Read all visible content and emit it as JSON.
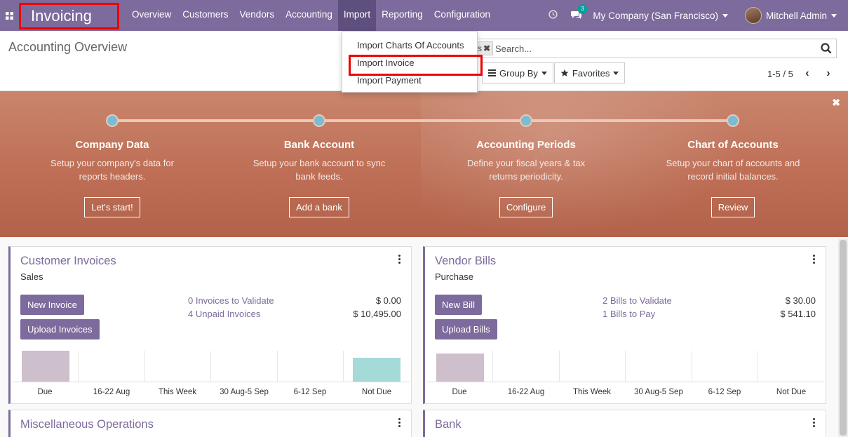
{
  "app": {
    "name": "Invoicing"
  },
  "nav": {
    "items": [
      "Overview",
      "Customers",
      "Vendors",
      "Accounting",
      "Import",
      "Reporting",
      "Configuration"
    ],
    "active": "Import"
  },
  "topbar": {
    "clock_icon": "clock-icon",
    "chat_badge": "3",
    "company": "My Company (San Francisco)",
    "user": "Mitchell Admin"
  },
  "import_menu": {
    "items": [
      "Import Charts Of Accounts",
      "Import Invoice",
      "Import Payment"
    ],
    "highlighted": "Import Invoice"
  },
  "control_panel": {
    "title": "Accounting Overview",
    "facet_text": "s",
    "search_placeholder": "Search...",
    "group_by": "Group By",
    "favorites": "Favorites",
    "pager": "1-5 / 5"
  },
  "onboarding": {
    "steps": [
      {
        "title": "Company Data",
        "desc1": "Setup your company's data for",
        "desc2": "reports headers.",
        "button": "Let's start!"
      },
      {
        "title": "Bank Account",
        "desc1": "Setup your bank account to sync",
        "desc2": "bank feeds.",
        "button": "Add a bank"
      },
      {
        "title": "Accounting Periods",
        "desc1": "Define your fiscal years & tax",
        "desc2": "returns periodicity.",
        "button": "Configure"
      },
      {
        "title": "Chart of Accounts",
        "desc1": "Setup your chart of accounts and",
        "desc2": "record initial balances.",
        "button": "Review"
      }
    ]
  },
  "cards": {
    "customer": {
      "title": "Customer Invoices",
      "subtitle": "Sales",
      "btn1": "New Invoice",
      "btn2": "Upload Invoices",
      "link1": "0 Invoices to Validate",
      "amount1": "$ 0.00",
      "link2": "4 Unpaid Invoices",
      "amount2": "$ 10,495.00",
      "chart_labels": [
        "Due",
        "16-22 Aug",
        "This Week",
        "30 Aug-5 Sep",
        "6-12 Sep",
        "Not Due"
      ]
    },
    "vendor": {
      "title": "Vendor Bills",
      "subtitle": "Purchase",
      "btn1": "New Bill",
      "btn2": "Upload Bills",
      "link1": "2 Bills to Validate",
      "amount1": "$ 30.00",
      "link2": "1 Bills to Pay",
      "amount2": "$ 541.10",
      "chart_labels": [
        "Due",
        "16-22 Aug",
        "This Week",
        "30 Aug-5 Sep",
        "6-12 Sep",
        "Not Due"
      ]
    },
    "misc": {
      "title": "Miscellaneous Operations"
    },
    "bank": {
      "title": "Bank"
    }
  },
  "colors": {
    "brand": "#7c6b9c",
    "highlight_box": "#ee0000",
    "due_bar": "#cdbfcb",
    "notdue_bar": "#a4dad8"
  }
}
